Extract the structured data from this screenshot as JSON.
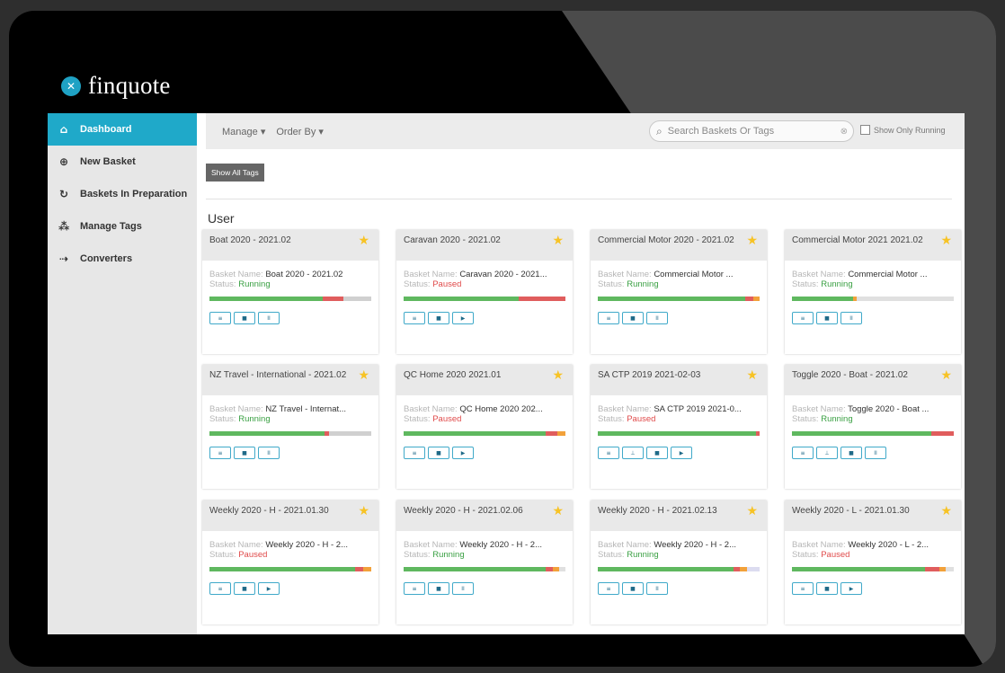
{
  "brand": {
    "name": "finquote",
    "accent": "#1fa9c9"
  },
  "sidebar": {
    "items": [
      {
        "label": "Dashboard",
        "icon": "home-icon",
        "active": true
      },
      {
        "label": "New Basket",
        "icon": "plus-circle-icon",
        "active": false
      },
      {
        "label": "Baskets In Preparation",
        "icon": "refresh-icon",
        "active": false
      },
      {
        "label": "Manage Tags",
        "icon": "users-icon",
        "active": false
      },
      {
        "label": "Converters",
        "icon": "converter-icon",
        "active": false
      }
    ]
  },
  "toolbar": {
    "manage_label": "Manage",
    "order_label": "Order By",
    "search_placeholder": "Search Baskets Or Tags",
    "show_running_label": "Show Only Running"
  },
  "show_all_tags_label": "Show All Tags",
  "section_title": "User",
  "basket_name_label": "Basket Name:",
  "status_label": "Status:",
  "cards": [
    {
      "title": "Boat 2020 - 2021.02",
      "basket_name": "Boat 2020 - 2021.02",
      "status": "Running",
      "progress": [
        [
          "#5fb85f",
          0.7
        ],
        [
          "#e05d5d",
          0.13
        ],
        [
          "#d0d0d0",
          0.17
        ]
      ],
      "controls": [
        "≡",
        "■",
        "II"
      ]
    },
    {
      "title": "Caravan 2020 - 2021.02",
      "basket_name": "Caravan 2020 - 2021...",
      "status": "Paused",
      "progress": [
        [
          "#5fb85f",
          0.71
        ],
        [
          "#e05d5d",
          0.29
        ]
      ],
      "controls": [
        "≡",
        "■",
        "▶"
      ]
    },
    {
      "title": "Commercial Motor 2020 - 2021.02",
      "basket_name": "Commercial Motor ...",
      "status": "Running",
      "progress": [
        [
          "#5fb85f",
          0.91
        ],
        [
          "#e05d5d",
          0.05
        ],
        [
          "#f2a13a",
          0.04
        ]
      ],
      "controls": [
        "≡",
        "■",
        "II"
      ]
    },
    {
      "title": "Commercial Motor 2021 2021.02",
      "basket_name": "Commercial Motor ...",
      "status": "Running",
      "progress": [
        [
          "#5fb85f",
          0.38
        ],
        [
          "#f2a13a",
          0.02
        ],
        [
          "#e0e0e0",
          0.6
        ]
      ],
      "controls": [
        "≡",
        "■",
        "II"
      ]
    },
    {
      "title": "NZ Travel - International - 2021.02",
      "basket_name": "NZ Travel - Internat...",
      "status": "Running",
      "progress": [
        [
          "#5fb85f",
          0.71
        ],
        [
          "#e05d5d",
          0.03
        ],
        [
          "#d0d0d0",
          0.26
        ]
      ],
      "controls": [
        "≡",
        "■",
        "II"
      ]
    },
    {
      "title": "QC Home 2020 2021.01",
      "basket_name": "QC Home 2020 202...",
      "status": "Paused",
      "progress": [
        [
          "#5fb85f",
          0.88
        ],
        [
          "#e05d5d",
          0.07
        ],
        [
          "#f2a13a",
          0.05
        ]
      ],
      "controls": [
        "≡",
        "■",
        "▶"
      ]
    },
    {
      "title": "SA CTP 2019 2021-02-03",
      "basket_name": "SA CTP 2019 2021-0...",
      "status": "Paused",
      "progress": [
        [
          "#5fb85f",
          0.98
        ],
        [
          "#e05d5d",
          0.02
        ]
      ],
      "controls": [
        "≡",
        "⊥",
        "■",
        "▶"
      ]
    },
    {
      "title": "Toggle 2020 - Boat - 2021.02",
      "basket_name": "Toggle 2020 - Boat ...",
      "status": "Running",
      "progress": [
        [
          "#5fb85f",
          0.86
        ],
        [
          "#e05d5d",
          0.14
        ]
      ],
      "controls": [
        "≡",
        "⊥",
        "■",
        "II"
      ]
    },
    {
      "title": "Weekly 2020 - H - 2021.01.30",
      "basket_name": "Weekly 2020 - H - 2...",
      "status": "Paused",
      "progress": [
        [
          "#5fb85f",
          0.9
        ],
        [
          "#e05d5d",
          0.05
        ],
        [
          "#f2a13a",
          0.05
        ]
      ],
      "controls": [
        "≡",
        "■",
        "▶"
      ]
    },
    {
      "title": "Weekly 2020 - H - 2021.02.06",
      "basket_name": "Weekly 2020 - H - 2...",
      "status": "Running",
      "progress": [
        [
          "#5fb85f",
          0.88
        ],
        [
          "#e05d5d",
          0.04
        ],
        [
          "#f2a13a",
          0.04
        ],
        [
          "#e0e0e0",
          0.04
        ]
      ],
      "controls": [
        "≡",
        "■",
        "II"
      ]
    },
    {
      "title": "Weekly 2020 - H - 2021.02.13",
      "basket_name": "Weekly 2020 - H - 2...",
      "status": "Running",
      "progress": [
        [
          "#5fb85f",
          0.84
        ],
        [
          "#e05d5d",
          0.04
        ],
        [
          "#f2a13a",
          0.04
        ],
        [
          "#dcdcf0",
          0.08
        ]
      ],
      "controls": [
        "≡",
        "■",
        "II"
      ]
    },
    {
      "title": "Weekly 2020 - L - 2021.01.30",
      "basket_name": "Weekly 2020 - L - 2...",
      "status": "Paused",
      "progress": [
        [
          "#5fb85f",
          0.82
        ],
        [
          "#e05d5d",
          0.09
        ],
        [
          "#f2a13a",
          0.04
        ],
        [
          "#e0e0e0",
          0.05
        ]
      ],
      "controls": [
        "≡",
        "■",
        "▶"
      ]
    }
  ]
}
